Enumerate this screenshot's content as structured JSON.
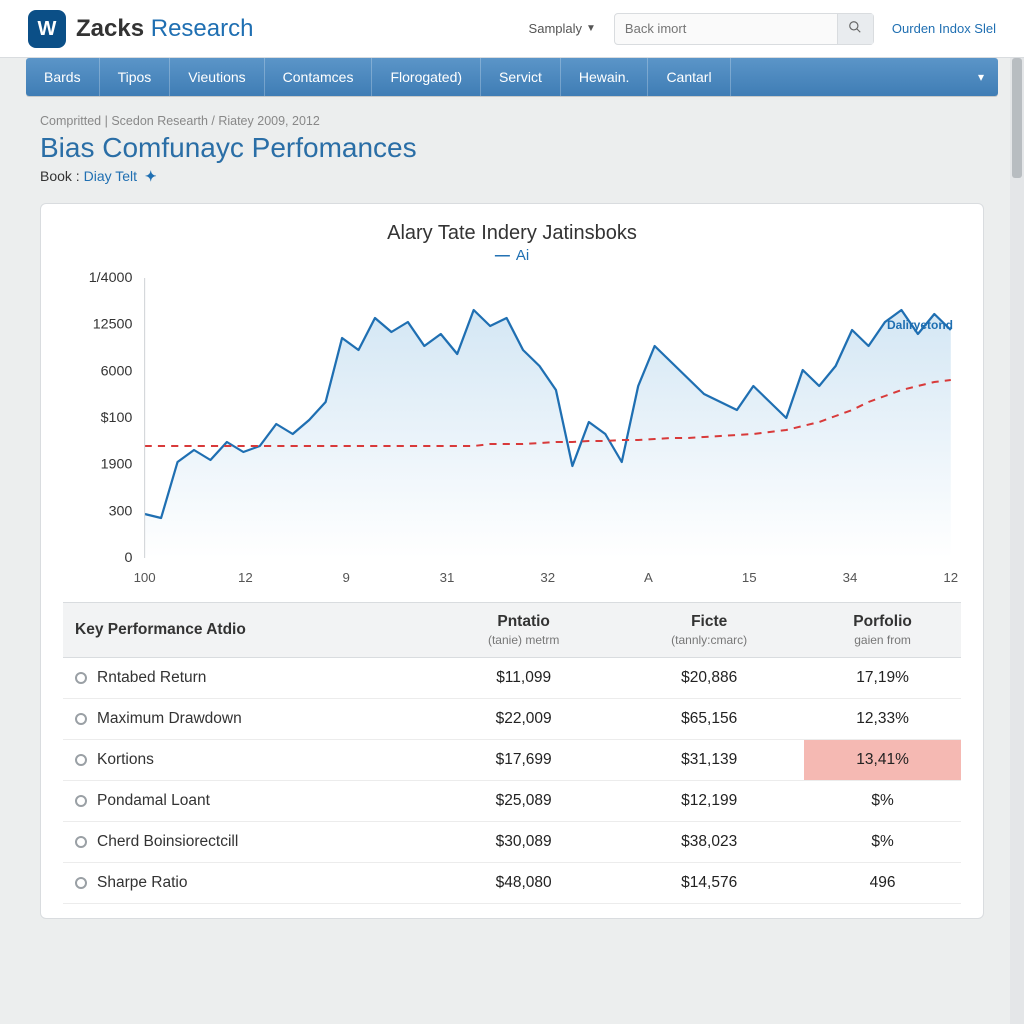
{
  "header": {
    "brand_bold": "Zacks",
    "brand_light": "Research",
    "logo_glyph": "W",
    "dropdown_label": "Samplaly",
    "search_placeholder": "Back imort",
    "right_link": "Ourden Indox Slel"
  },
  "nav": {
    "items": [
      "Bards",
      "Tipos",
      "Vieutions",
      "Contamces",
      "Florogated)",
      "Servict",
      "Hewain.",
      "Cantarl"
    ]
  },
  "breadcrumb": "Compritted | Scedon Researth  /  Riatey 2009, 2012",
  "page_title": "Bias Comfunayc Perfomances",
  "book_label": "Book :",
  "book_link": "Diay Telt",
  "chart": {
    "title": "Alary Tate Indery Jatinsboks",
    "legend": "Ai",
    "annotation": "Daliryetond"
  },
  "chart_data": {
    "type": "line",
    "x_labels": [
      "100",
      "12",
      "9",
      "31",
      "32",
      "A",
      "15",
      "34",
      "12"
    ],
    "y_labels": [
      "0",
      "300",
      "1900",
      "$100",
      "6000",
      "12500",
      "1/4000"
    ],
    "ylim": [
      0,
      14000
    ],
    "series": [
      {
        "name": "Ai",
        "color": "#1f6fb2",
        "area": true,
        "values": [
          2200,
          2000,
          4800,
          5400,
          4900,
          5800,
          5300,
          5600,
          6700,
          6200,
          6900,
          7800,
          11000,
          10400,
          12000,
          11300,
          11800,
          10600,
          11200,
          10200,
          12400,
          11600,
          12000,
          10400,
          9600,
          8400,
          4600,
          6800,
          6200,
          4800,
          8600,
          10600,
          9800,
          9000,
          8200,
          7800,
          7400,
          8600,
          7800,
          7000,
          9400,
          8600,
          9600,
          11400,
          10600,
          11800,
          12400,
          11200,
          12200,
          11400
        ]
      },
      {
        "name": "baseline",
        "color": "#d83a3a",
        "dashed": true,
        "values": [
          5600,
          5600,
          5600,
          5600,
          5600,
          5600,
          5600,
          5600,
          5600,
          5600,
          5600,
          5600,
          5600,
          5600,
          5600,
          5600,
          5600,
          5600,
          5600,
          5600,
          5600,
          5700,
          5700,
          5700,
          5750,
          5800,
          5800,
          5850,
          5850,
          5900,
          5900,
          5950,
          6000,
          6000,
          6050,
          6100,
          6150,
          6200,
          6300,
          6400,
          6600,
          6800,
          7100,
          7400,
          7800,
          8100,
          8400,
          8600,
          8800,
          8900
        ]
      }
    ]
  },
  "table": {
    "headers": {
      "metric": "Key Performance Atdio",
      "col1": "Pntatio",
      "col1_sub": "(tanie) metrm",
      "col2": "Ficte",
      "col2_sub": "(tannly:cmarc)",
      "col3": "Porfolio",
      "col3_sub": "gaien from"
    },
    "rows": [
      {
        "metric": "Rntabed Return",
        "c1": "$11,099",
        "c2": "$20,886",
        "c3": "17,19%",
        "hl": false
      },
      {
        "metric": "Maximum Drawdown",
        "c1": "$22,009",
        "c2": "$65,156",
        "c3": "12,33%",
        "hl": false
      },
      {
        "metric": "Kortions",
        "c1": "$17,699",
        "c2": "$31,139",
        "c3": "13,41%",
        "hl": true
      },
      {
        "metric": "Pondamal Loant",
        "c1": "$25,089",
        "c2": "$12,199",
        "c3": "$%",
        "hl": false
      },
      {
        "metric": "Cherd Boinsiorectcill",
        "c1": "$30,089",
        "c2": "$38,023",
        "c3": "$%",
        "hl": false
      },
      {
        "metric": "Sharpe Ratio",
        "c1": "$48,080",
        "c2": "$14,576",
        "c3": "496",
        "hl": false
      }
    ]
  }
}
